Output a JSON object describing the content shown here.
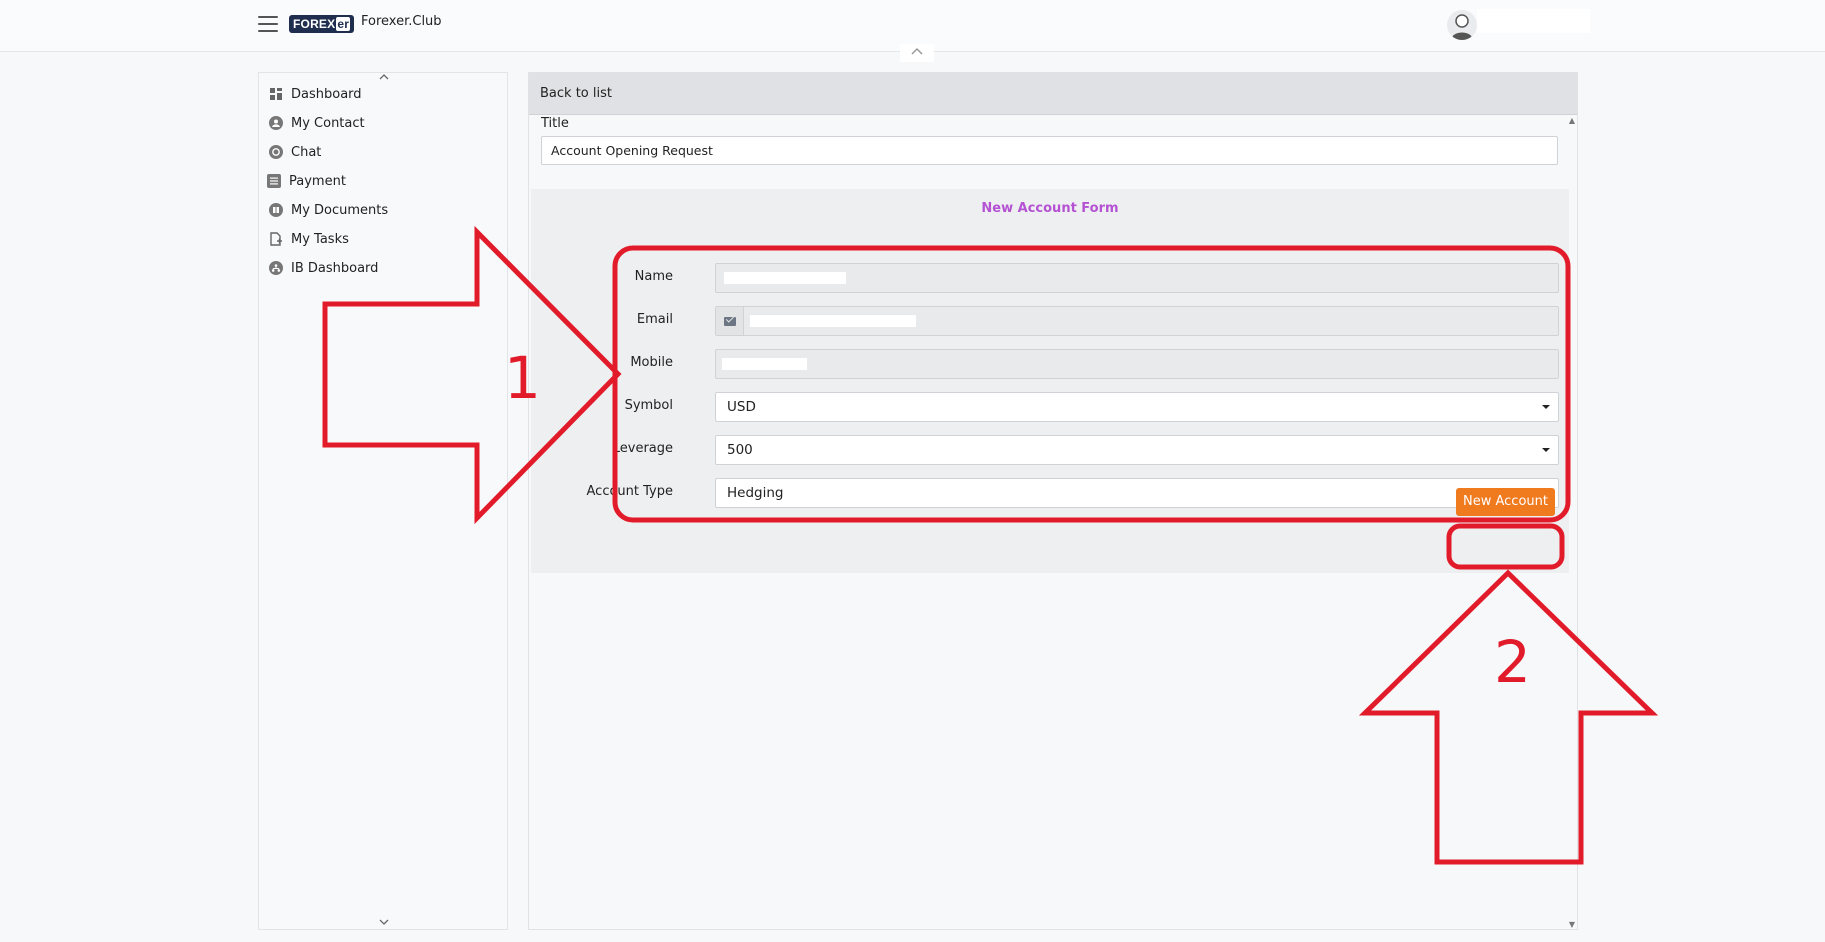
{
  "header": {
    "logo_text": "FOREX",
    "logo_suffix": "er",
    "site_name": "Forexer.Club",
    "collapse_arrow": "^"
  },
  "sidebar": {
    "scroll_up": "^",
    "scroll_down": "v",
    "items": [
      {
        "label": "Dashboard",
        "icon": "grid-icon"
      },
      {
        "label": "My Contact",
        "icon": "contact-icon"
      },
      {
        "label": "Chat",
        "icon": "chat-icon"
      },
      {
        "label": "Payment",
        "icon": "list-icon"
      },
      {
        "label": "My Documents",
        "icon": "documents-icon"
      },
      {
        "label": "My Tasks",
        "icon": "task-icon"
      },
      {
        "label": "IB Dashboard",
        "icon": "network-icon"
      }
    ]
  },
  "main": {
    "back_label": "Back to list",
    "title_label": "Title",
    "title_value": "Account Opening Request",
    "form": {
      "heading": "New Account Form",
      "name_label": "Name",
      "email_label": "Email",
      "mobile_label": "Mobile",
      "symbol_label": "Symbol",
      "symbol_value": "USD",
      "leverage_label": "Leverage",
      "leverage_value": "500",
      "account_type_label": "Account Type",
      "account_type_value": "Hedging",
      "submit_label": "New Account"
    }
  },
  "annotations": {
    "marker_1": "1",
    "marker_2": "2",
    "color": "#e21b2a"
  }
}
